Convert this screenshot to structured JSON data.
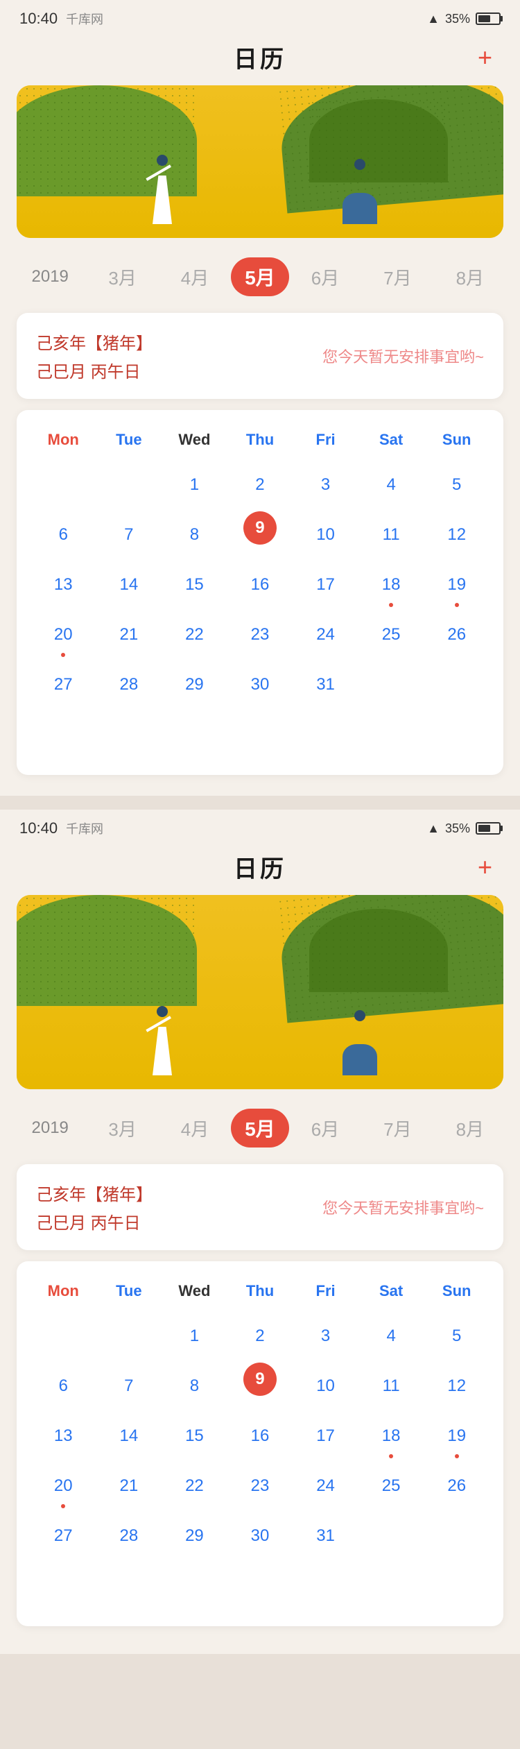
{
  "screen1": {
    "statusBar": {
      "time": "10:40",
      "brand": "千库网",
      "battery": "35%"
    },
    "header": {
      "title": "日历",
      "addIcon": "+"
    },
    "monthPicker": {
      "year": "2019",
      "months": [
        "3月",
        "4月",
        "5月",
        "6月",
        "7月",
        "8月"
      ],
      "activeMonth": "5月",
      "activeIndex": 2
    },
    "lunarInfo": {
      "line1": "己亥年【猪年】",
      "line2": "己巳月  丙午日",
      "noEvent": "您今天暂无安排事宜哟~"
    },
    "calendar": {
      "dayLabels": [
        "Mon",
        "Tue",
        "Wed",
        "Thu",
        "Fri",
        "Sat",
        "Sun"
      ],
      "weeks": [
        [
          "",
          "",
          "1",
          "2",
          "3",
          "4",
          "5"
        ],
        [
          "6",
          "7",
          "8",
          "9",
          "10",
          "11",
          "12"
        ],
        [
          "13",
          "14",
          "15",
          "16",
          "17",
          "18",
          "19"
        ],
        [
          "20",
          "21",
          "22",
          "23",
          "24",
          "25",
          "26"
        ],
        [
          "27",
          "28",
          "29",
          "30",
          "31",
          "",
          ""
        ]
      ],
      "today": "9",
      "hasDot": [
        "18",
        "19",
        "20"
      ]
    }
  },
  "screen2": {
    "statusBar": {
      "time": "10:40",
      "brand": "千库网",
      "battery": "35%"
    },
    "header": {
      "title": "日历",
      "addIcon": "+"
    },
    "monthPicker": {
      "year": "2019",
      "months": [
        "3月",
        "4月",
        "5月",
        "6月",
        "7月",
        "8月"
      ],
      "activeMonth": "5月",
      "activeIndex": 2
    },
    "lunarInfo": {
      "line1": "己亥年【猪年】",
      "line2": "己巳月  丙午日",
      "noEvent": "您今天暂无安排事宜哟~"
    },
    "calendar": {
      "dayLabels": [
        "Mon",
        "Tue",
        "Wed",
        "Thu",
        "Fri",
        "Sat",
        "Sun"
      ],
      "weeks": [
        [
          "",
          "",
          "1",
          "2",
          "3",
          "4",
          "5"
        ],
        [
          "6",
          "7",
          "8",
          "9",
          "10",
          "11",
          "12"
        ],
        [
          "13",
          "14",
          "15",
          "16",
          "17",
          "18",
          "19"
        ],
        [
          "20",
          "21",
          "22",
          "23",
          "24",
          "25",
          "26"
        ],
        [
          "27",
          "28",
          "29",
          "30",
          "31",
          "",
          ""
        ]
      ],
      "today": "9",
      "hasDot": [
        "18",
        "19",
        "20"
      ]
    }
  }
}
